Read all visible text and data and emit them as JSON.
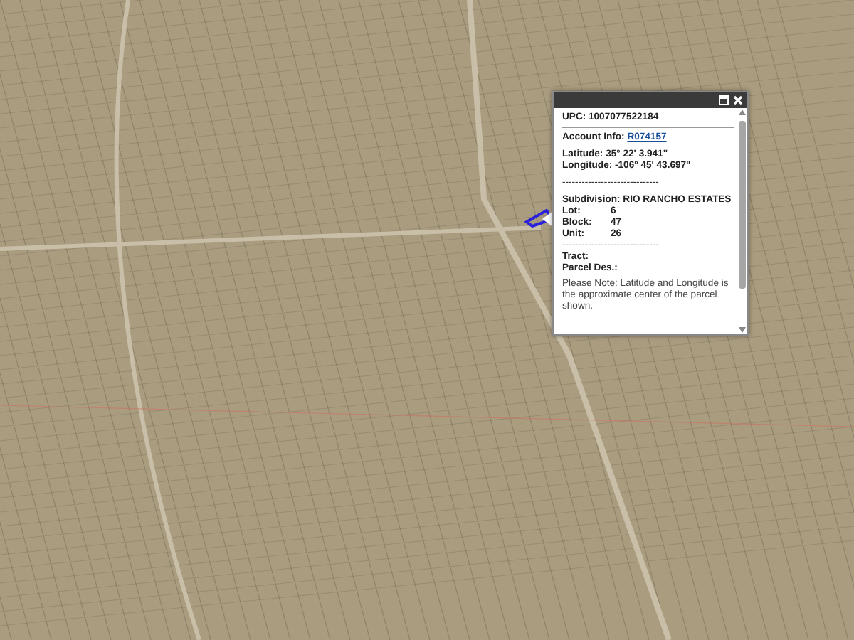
{
  "popup": {
    "upc": "UPC: 1007077522184",
    "account_label": "Account Info:",
    "account_link": "R074157",
    "latitude": "Latitude: 35° 22' 3.941\"",
    "longitude": "Longitude: -106° 45' 43.697\"",
    "separator_1": "------------------------------",
    "subdivision": "Subdivision: RIO RANCHO ESTATES",
    "fields": [
      {
        "label": "Lot:",
        "value": "6"
      },
      {
        "label": "Block:",
        "value": "47"
      },
      {
        "label": "Unit:",
        "value": "26"
      }
    ],
    "separator_2": "------------------------------",
    "tract": "Tract:",
    "parcel": "Parcel Des.:",
    "note": "Please Note: Latitude and Longitude is the approximate center of the parcel shown."
  }
}
